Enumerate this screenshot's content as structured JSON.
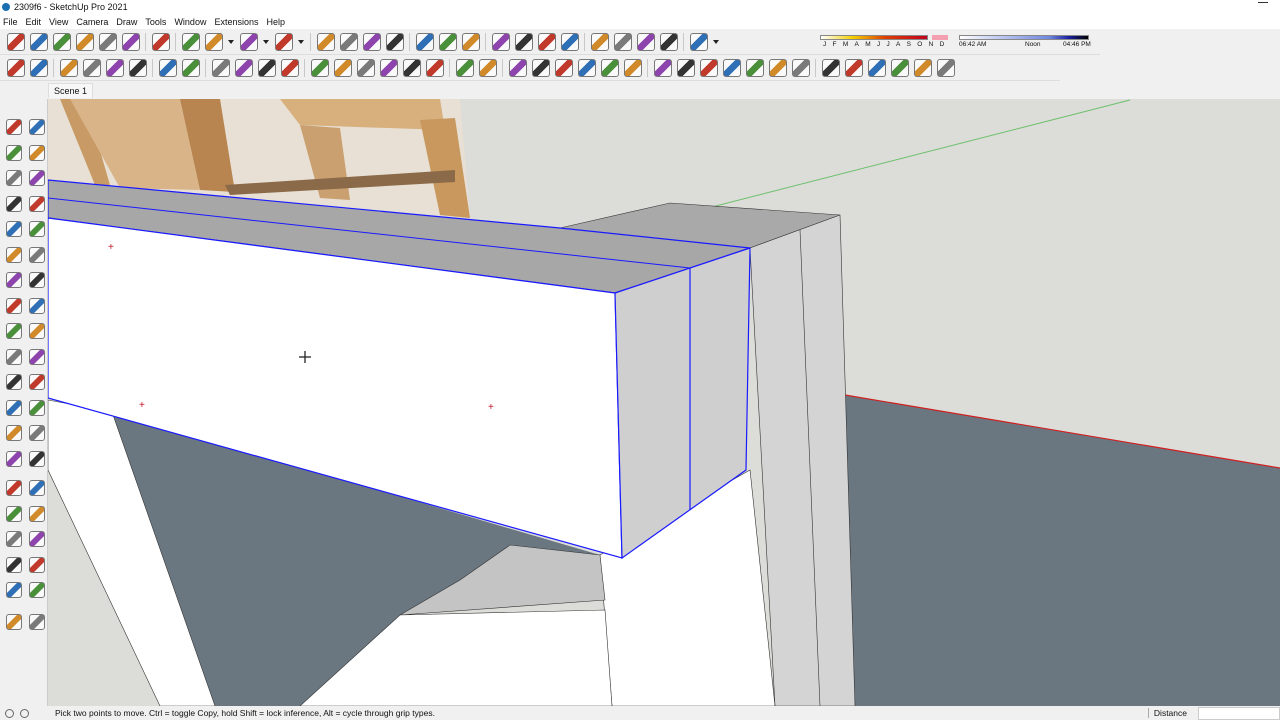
{
  "window": {
    "title": "2309f6 - SketchUp Pro 2021"
  },
  "menu": [
    "File",
    "Edit",
    "View",
    "Camera",
    "Draw",
    "Tools",
    "Window",
    "Extensions",
    "Help"
  ],
  "toolbar_row1": [
    "iso-view-icon",
    "front-view-icon",
    "home-icon",
    "top-view-icon",
    "outline-house-icon",
    "back-view-icon",
    "|",
    "select-arrow-icon",
    "|",
    "eraser-icon",
    "pencil-icon",
    "v",
    "arc-icon",
    "v",
    "rectangle-icon",
    "v",
    "|",
    "push-pull-icon",
    "follow-me-icon",
    "move-icon",
    "rotate-icon",
    "|",
    "tape-measure-icon",
    "text-icon",
    "paint-bucket-icon",
    "|",
    "orbit-icon",
    "pan-icon",
    "zoom-icon",
    "zoom-extents-icon",
    "|",
    "section-plane-icon",
    "section-display-icon",
    "section-cut-icon",
    "section-fill-icon",
    "|",
    "geo-location-icon",
    "v"
  ],
  "toolbar_row2": [
    "styles-icon",
    "palette-icon",
    "|",
    "teapot-icon",
    "teapot-hand-icon",
    "fog-icon",
    "refresh-view-icon",
    "|",
    "shadow-icon",
    "shadow-face-icon",
    "|",
    "window-icon",
    "window-teapot-icon",
    "window-landscape-icon",
    "lock-icon",
    "|",
    "xray-icon",
    "component-icon",
    "box-icon",
    "wireframe-icon",
    "hidden-line-icon",
    "shaded-icon",
    "|",
    "group-icon",
    "solid-union-icon",
    "|",
    "solid-tools-icon",
    "intersect-icon",
    "subtract-icon",
    "trim-icon",
    "split-icon",
    "outer-shell-icon",
    "|",
    "sandbox-from-contours-icon",
    "sandbox-from-scratch-icon",
    "smoove-icon",
    "stamp-icon",
    "drape-icon",
    "add-detail-icon",
    "flip-edge-icon",
    "|",
    "warehouse-icon",
    "extension-warehouse-icon",
    "layout-icon",
    "send-to-layout-icon",
    "ruby-console-icon",
    "red-flag-icon"
  ],
  "shadow": {
    "months": [
      "J",
      "F",
      "M",
      "A",
      "M",
      "J",
      "J",
      "A",
      "S",
      "O",
      "N",
      "D"
    ],
    "time_start": "06:42 AM",
    "time_mid": "Noon",
    "time_end": "04:46 PM"
  },
  "scene_tab": "Scene 1",
  "left_tools": [
    "select-icon",
    "component-select-icon",
    "paint-bucket-icon",
    "eraser-icon",
    "pencil-icon",
    "freehand-icon",
    "rectangle-icon",
    "rotated-rectangle-icon",
    "circle-icon",
    "polygon-icon",
    "arc-icon",
    "two-point-arc-icon",
    "three-point-arc-icon",
    "pie-icon",
    "move-icon",
    "push-pull-icon",
    "rotate-icon",
    "follow-me-icon",
    "scale-icon",
    "offset-icon",
    "tape-measure-icon",
    "dimension-icon",
    "protractor-icon",
    "text-icon",
    "axes-icon",
    "3d-text-icon",
    "orbit-icon",
    "pan-icon",
    "zoom-icon",
    "zoom-window-icon",
    "zoom-extents-icon",
    "previous-view-icon",
    "position-camera-icon",
    "look-around-icon",
    "walk-icon",
    "section-plane-icon",
    "add-location-icon",
    "toggle-terrain-icon",
    "photo-texture-icon",
    "match-photo-icon"
  ],
  "status": {
    "message": "Pick two points to move.  Ctrl = toggle Copy, hold Shift = lock inference, Alt = cycle through grip types.",
    "measure_label": "Distance",
    "measure_value": ""
  },
  "colors": {
    "selection": "#1a1aff",
    "ground": "#6a7781",
    "wood": "#d9b48a"
  }
}
